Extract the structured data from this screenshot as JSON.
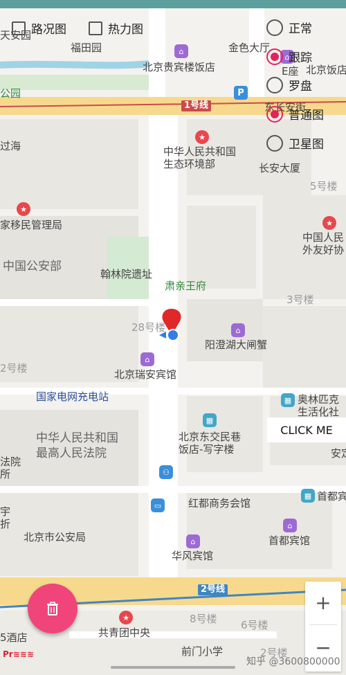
{
  "checkboxes": [
    {
      "label": "路况图"
    },
    {
      "label": "热力图"
    }
  ],
  "map_modes": [
    {
      "label": "正常",
      "selected": false
    },
    {
      "label": "跟踪",
      "selected": true
    },
    {
      "label": "罗盘",
      "selected": false
    },
    {
      "label": "普通图",
      "selected": true
    },
    {
      "label": "卫星图",
      "selected": false
    }
  ],
  "click_button": "CLICK ME",
  "zoom": {
    "in": "+",
    "out": "−"
  },
  "watermark": "知乎 @3600800000",
  "logo": "Pr≋≋≋",
  "map_labels": {
    "tiananmen": "天安园",
    "futian": "福田园",
    "beijing_hotel": "北京贵宾楼饭店",
    "jinse": "金色大厅",
    "eblock": "E座",
    "beijing_fandian": "北京饭店",
    "park": "公园",
    "line1": "1号线",
    "dongchang": "东长安街",
    "guo": "过海",
    "ministry_env": "中华人民共和国\n生态环境部",
    "changan": "长安大厦",
    "bldg5": "5号楼",
    "immigration": "家移民管理局",
    "friendship": "中国人民\n外友好协",
    "police_ministry": "中国公安部",
    "hanlin": "翰林院遗址",
    "suqin": "肃亲王府",
    "bldg3": "3号楼",
    "bldg28": "28号楼",
    "yangcheng": "阳澄湖大闸蟹",
    "bldg2": "2号楼",
    "ruian": "北京瑞安宾馆",
    "grid_station": "国家电网充电站",
    "olympic": "奥林匹克\n生活化社",
    "supreme_court": "中华人民共和国\n最高人民法院",
    "jiaomin": "北京东交民巷\n饭店-写字楼",
    "court_left": "法院\n所",
    "anding": "安定",
    "shoudu_bin": "首都宾",
    "hongdu": "红都商务会馆",
    "yu": "宇\n折",
    "police_beijing": "北京市公安局",
    "shoudu_hotel": "首都宾馆",
    "huafeng": "华风宾馆",
    "line2": "2号线",
    "gongqingtuan": "共青团中央",
    "bldg8": "8号楼",
    "bldg6": "6号楼",
    "hotel_left": "5酒店",
    "qianmen": "前门小学",
    "bldg2b": "2号楼"
  }
}
